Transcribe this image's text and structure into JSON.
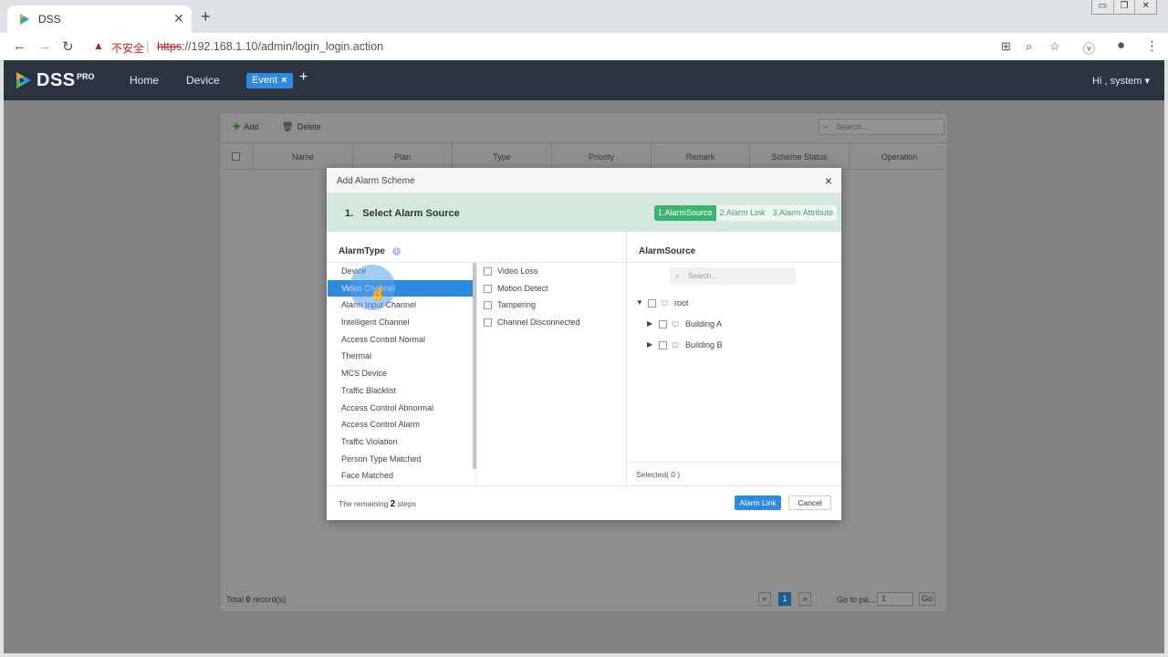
{
  "browser": {
    "tab_title": "DSS",
    "tab_close": "✕",
    "new_tab": "+",
    "window_controls": [
      "▭",
      "❐",
      "✕"
    ],
    "insecure_label": "不安全",
    "url_scheme": "https",
    "url_rest": "://192.168.1.10/admin/login_login.action"
  },
  "app": {
    "logo_text": "DSS",
    "logo_pro": "PRO",
    "nav": {
      "home": "Home",
      "device": "Device",
      "event": "Event",
      "event_close": "×",
      "add": "+"
    },
    "user": "Hi , system ▾"
  },
  "background_panel": {
    "add_label": "Add",
    "delete_label": "Delete",
    "search_placeholder": "Search...",
    "columns": [
      "Name",
      "Plan",
      "Type",
      "Priority",
      "Remark",
      "Scheme Status",
      "Operation"
    ],
    "total_prefix": "Total",
    "total_count": "0",
    "total_suffix": "record(s)",
    "page_prev": "«",
    "page_current": "1",
    "page_next": "»",
    "goto_label": "Go to pa...",
    "goto_value": "1",
    "goto_button": "Go"
  },
  "modal": {
    "title": "Add Alarm Scheme",
    "close": "×",
    "step_number": "1.",
    "step_title": "Select Alarm Source",
    "steps": [
      "1.AlarmSource",
      "2.Alarm Link",
      "3.Alarm Attribute"
    ],
    "alarm_type_header": "AlarmType",
    "alarm_source_header": "AlarmSource",
    "alarm_types": [
      "Device",
      "Video Channel",
      "Alarm Input Channel",
      "Intelligent Channel",
      "Access Control Normal",
      "Thermal",
      "MCS Device",
      "Traffic Blacklist",
      "Access Control Abnormal",
      "Access Control Alarm",
      "Traffic Violation",
      "Person Type Matched",
      "Face Matched"
    ],
    "selected_type_index": 1,
    "sub_types": [
      "Video Loss",
      "Motion Detect",
      "Tampering",
      "Channel Disconnected"
    ],
    "source_search_placeholder": "Search...",
    "tree": {
      "root": "root",
      "children": [
        "Building A",
        "Building B"
      ]
    },
    "selected_label": "Selected( 0 )",
    "remaining_prefix": "The remaining",
    "remaining_count": "2",
    "remaining_suffix": "steps",
    "next_button": "Alarm Link",
    "cancel_button": "Cancel"
  },
  "colors": {
    "header_bg": "#2c343f",
    "accent": "#2d8ae0",
    "step_active": "#3cb371",
    "step_bar_bg": "#d4e9de"
  }
}
